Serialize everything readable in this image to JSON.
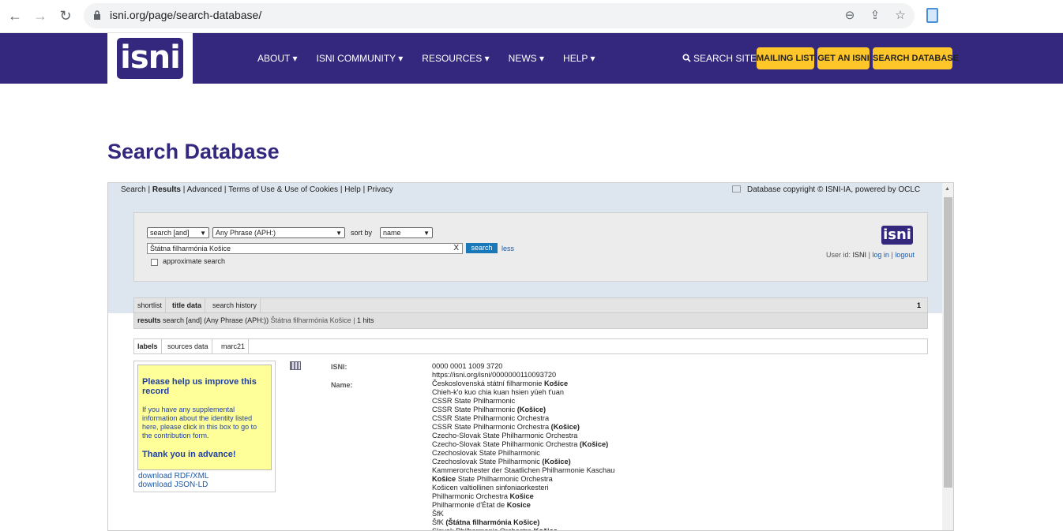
{
  "browser": {
    "url": "isni.org/page/search-database/",
    "back_icon": "←",
    "forward_icon": "→",
    "reload_icon": "↻",
    "zoom_icon": "⊖",
    "share_icon": "⇪",
    "star_icon": "☆"
  },
  "site": {
    "logo_text": "isni",
    "nav": [
      "ABOUT ▾",
      "ISNI COMMUNITY ▾",
      "RESOURCES ▾",
      "NEWS ▾",
      "HELP ▾"
    ],
    "search_site": "SEARCH SITE",
    "buttons": [
      "MAILING LIST",
      "GET AN ISNI",
      "SEARCH DATABASE"
    ]
  },
  "page": {
    "title": "Search Database"
  },
  "db": {
    "top_links": {
      "search": "Search",
      "results": "Results",
      "advanced": "Advanced",
      "terms": "Terms of Use & Use of Cookies",
      "help": "Help",
      "privacy": "Privacy",
      "sep": "|"
    },
    "copyright": "Database copyright © ISNI-IA, powered by OCLC",
    "search": {
      "operator": "search [and]",
      "index": "Any Phrase (APH:)",
      "sort_label": "sort by",
      "sort_value": "name",
      "term": "Štátna filharmónia Košice",
      "clear": "X",
      "button": "search",
      "less": "less",
      "approx": "approximate search"
    },
    "logo": "isni",
    "user": {
      "label": "User id:",
      "id": "ISNI",
      "login": "log in",
      "logout": "logout",
      "sep": "|"
    },
    "tabs": [
      "shortlist",
      "title data",
      "search history"
    ],
    "tab_count": "1",
    "results": {
      "label": "results",
      "query": "search [and]  (Any Phrase (APH:))",
      "term": "Štátna filharmónia Košice",
      "sep": "|",
      "hits": "1 hits"
    },
    "sub_tabs": [
      "labels",
      "sources data",
      "marc21"
    ],
    "help_box": {
      "title": "Please help us improve this record",
      "body": "If you have any supplemental information about the identity listed here, please click in this box to go to the contribution form.",
      "thanks": "Thank you in advance!",
      "download_rdf": "download RDF/XML",
      "download_json": "download JSON-LD"
    },
    "record": {
      "isni_label": "ISNI:",
      "name_label": "Name:",
      "isni": "0000 0001 1009 3720",
      "uri": "https://isni.org/isni/0000000110093720",
      "names": [
        [
          "Československá státní filharmonie ",
          "Košice",
          ""
        ],
        [
          "Chieh-k'o kuo chia kuan hsien yüeh t'uan",
          "",
          ""
        ],
        [
          "CSSR State Philharmonic",
          "",
          ""
        ],
        [
          "CSSR State Philharmonic ",
          "(Košice)",
          ""
        ],
        [
          "CSSR State Philharmonic Orchestra",
          "",
          ""
        ],
        [
          "CSSR State Philharmonic Orchestra ",
          "(Košice)",
          ""
        ],
        [
          "Czecho-Slovak State Philharmonic Orchestra",
          "",
          ""
        ],
        [
          "Czecho-Slovak State Philharmonic Orchestra ",
          "(Košice)",
          ""
        ],
        [
          "Czechoslovak State Philharmonic",
          "",
          ""
        ],
        [
          "Czechoslovak State Philharmonic ",
          "(Košice)",
          ""
        ],
        [
          "Kammerorchester der Staatlichen Philharmonie Kaschau",
          "",
          ""
        ],
        [
          "",
          "Košice",
          " State Philharmonic Orchestra"
        ],
        [
          "Košicen valtiollinen sinfoniaorkesteri",
          "",
          ""
        ],
        [
          "Philharmonic Orchestra ",
          "Košice",
          ""
        ],
        [
          "Philharmonie d'État de ",
          "Kosice",
          ""
        ],
        [
          "ŠfK",
          "",
          ""
        ],
        [
          "ŠfK ",
          "(Štátna filharmónia Košice)",
          ""
        ],
        [
          "Slovak Philharmonic Orchestra ",
          "Košice",
          ""
        ]
      ]
    }
  }
}
